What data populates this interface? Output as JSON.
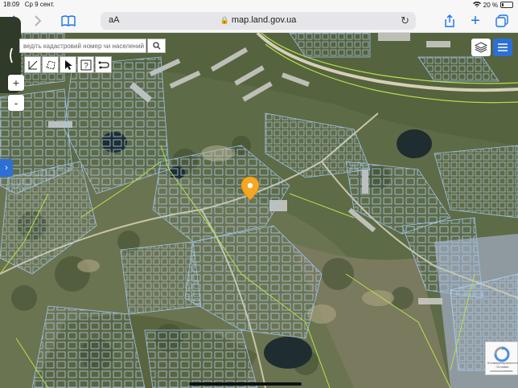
{
  "status_bar": {
    "time": "18:09",
    "date": "Ср 9 сент.",
    "battery_text": "20 %",
    "battery_level": 0.2
  },
  "browser": {
    "reader_label": "аА",
    "url": "map.land.gov.ua"
  },
  "map_ui": {
    "search_placeholder": "ведіть кадастровий номер чи населений пункт",
    "tools": [
      {
        "name": "measure-distance-tool",
        "icon": "ruler-distance-icon"
      },
      {
        "name": "measure-area-tool",
        "icon": "ruler-area-icon"
      },
      {
        "name": "pointer-tool",
        "icon": "cursor-arrow-icon"
      },
      {
        "name": "info-tool",
        "icon": "question-mark-icon"
      },
      {
        "name": "route-tool",
        "icon": "path-icon"
      }
    ],
    "zoom_in_label": "+",
    "zoom_out_label": "-",
    "expand_label": "›"
  },
  "colors": {
    "ios_blue": "#1a73e8",
    "panel_blue": "#2d6fd6",
    "marker": "#f5a623",
    "parcel_green": "#b6e04a",
    "parcel_blue": "#9fc3e8"
  },
  "recaptcha": {
    "legal": "Конфиденциальность · Условия использования"
  }
}
